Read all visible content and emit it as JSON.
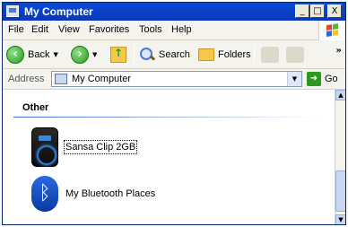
{
  "window": {
    "title": "My Computer"
  },
  "caption_buttons": {
    "minimize": "_",
    "maximize": "□",
    "close": "X"
  },
  "menu": {
    "items": [
      "File",
      "Edit",
      "View",
      "Favorites",
      "Tools",
      "Help"
    ]
  },
  "toolbar": {
    "back_label": "Back",
    "forward_label": "",
    "search_label": "Search",
    "folders_label": "Folders",
    "overflow": "»"
  },
  "address": {
    "label": "Address",
    "value": "My Computer",
    "go_label": "Go"
  },
  "content": {
    "group": "Other",
    "items": [
      {
        "label": "Sansa Clip 2GB",
        "icon": "media-player-icon"
      },
      {
        "label": "My Bluetooth Places",
        "icon": "bluetooth-icon"
      }
    ]
  },
  "colors": {
    "titlebar": "#0a4ad8",
    "chrome": "#ece9d8",
    "group_rule": "#3a6ad0",
    "nav_green": "#2a9a1e"
  }
}
